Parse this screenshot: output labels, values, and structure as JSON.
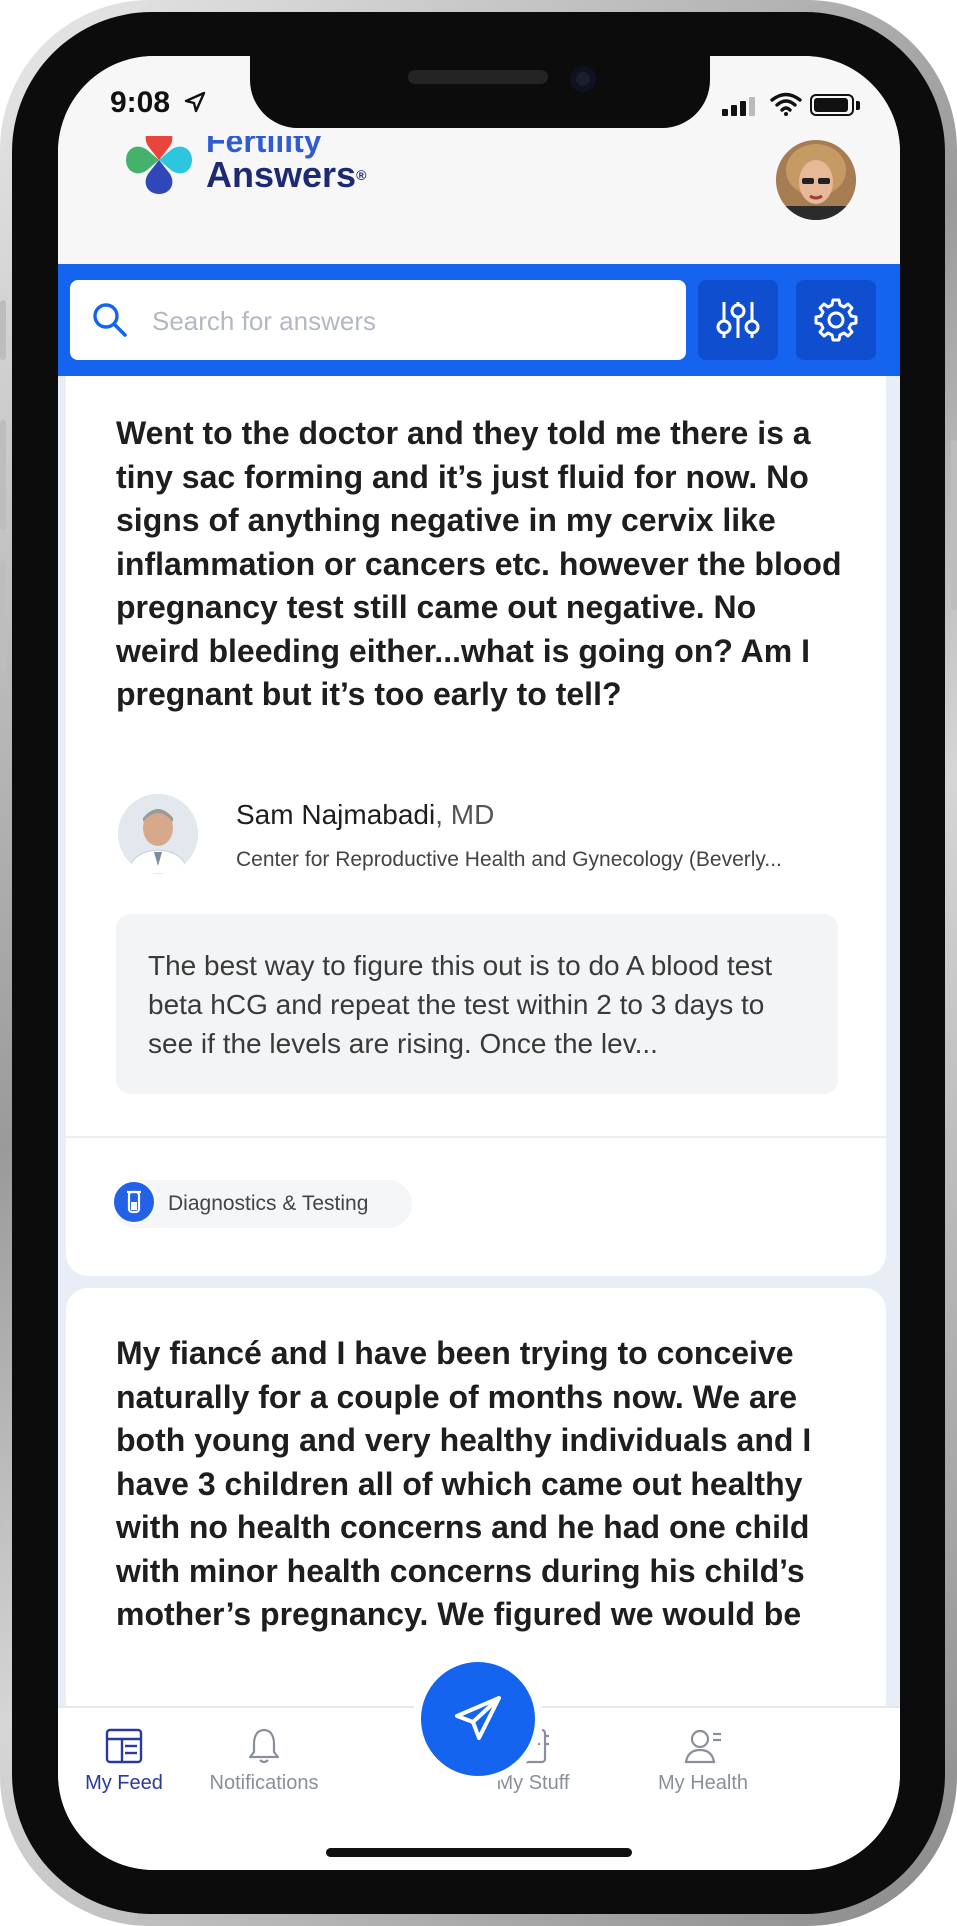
{
  "status": {
    "time": "9:08"
  },
  "brand": {
    "line1": "Fertility",
    "line2": "Answers",
    "mark": "®"
  },
  "search": {
    "placeholder": "Search for answers"
  },
  "feed": [
    {
      "question": "Went to the doctor and they told me there is a tiny sac forming and it’s just fluid for now. No signs of anything negative in my cervix like inflammation or cancers etc. however the blood pregnancy test still came out negative. No weird bleeding either...what is going on? Am I pregnant but it’s too early to tell?",
      "doctor": {
        "name": "Sam Najmabadi",
        "credential": ", MD",
        "clinic": "Center for Reproductive Health and Gynecology (Beverly..."
      },
      "answer": "The best way to figure this out is to do A blood test beta hCG and repeat the test within 2 to 3 days to see if the levels are rising. Once the lev...",
      "tag": "Diagnostics & Testing"
    },
    {
      "question": "My fiancé and I have been trying to conceive naturally for a couple of months now. We are both young and very healthy individuals and I have 3 children all of which came out healthy with no health concerns and he had one child with minor health concerns during his child’s mother’s pregnancy. We figured we would be"
    }
  ],
  "tabs": [
    {
      "label": "My Feed",
      "icon": "feed-icon",
      "active": true
    },
    {
      "label": "Notifications",
      "icon": "bell-icon"
    },
    {
      "label": "My Stuff",
      "icon": "notebook-icon"
    },
    {
      "label": "My Health",
      "icon": "user-health-icon"
    }
  ],
  "colors": {
    "primary": "#1464f0",
    "brand_dark": "#1d2a73",
    "active_tab": "#2a3a9a"
  }
}
